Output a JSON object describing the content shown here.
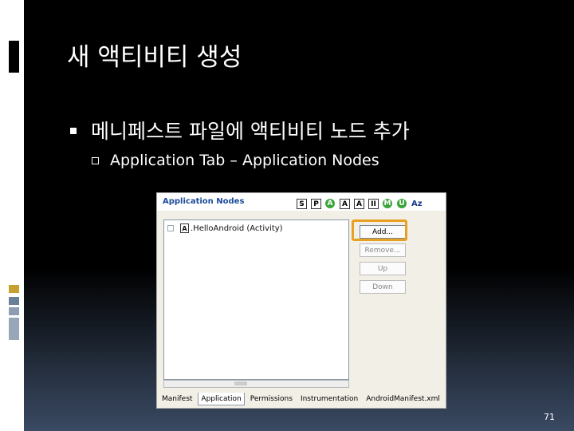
{
  "slide": {
    "title": "새 액티비티 생성",
    "bullet_1": "메니페스트 파일에 액티비티 노드 추가",
    "bullet_2": "Application Tab – Application Nodes",
    "page_number": "71"
  },
  "screenshot": {
    "section_title": "Application Nodes",
    "toolbar": [
      {
        "label": "S",
        "style": "box"
      },
      {
        "label": "P",
        "style": "box"
      },
      {
        "label": "A",
        "style": "green"
      },
      {
        "label": "A",
        "style": "box"
      },
      {
        "label": "A",
        "style": "box"
      },
      {
        "label": "II",
        "style": "box"
      },
      {
        "label": "M",
        "style": "green"
      },
      {
        "label": "U",
        "style": "green"
      },
      {
        "label": "Az",
        "style": "az"
      }
    ],
    "tree_items": [
      {
        "icon": "A",
        "label": ".HelloAndroid (Activity)"
      }
    ],
    "buttons": {
      "add": "Add...",
      "remove": "Remove...",
      "up": "Up",
      "down": "Down"
    },
    "tabs": [
      {
        "label": "Manifest",
        "selected": false
      },
      {
        "label": "Application",
        "selected": true
      },
      {
        "label": "Permissions",
        "selected": false
      },
      {
        "label": "Instrumentation",
        "selected": false
      },
      {
        "label": "AndroidManifest.xml",
        "selected": false
      }
    ]
  },
  "colors": {
    "highlight": "#e8a020",
    "heading_blue": "#1a4a9a",
    "accent_green": "#3aa63a"
  }
}
